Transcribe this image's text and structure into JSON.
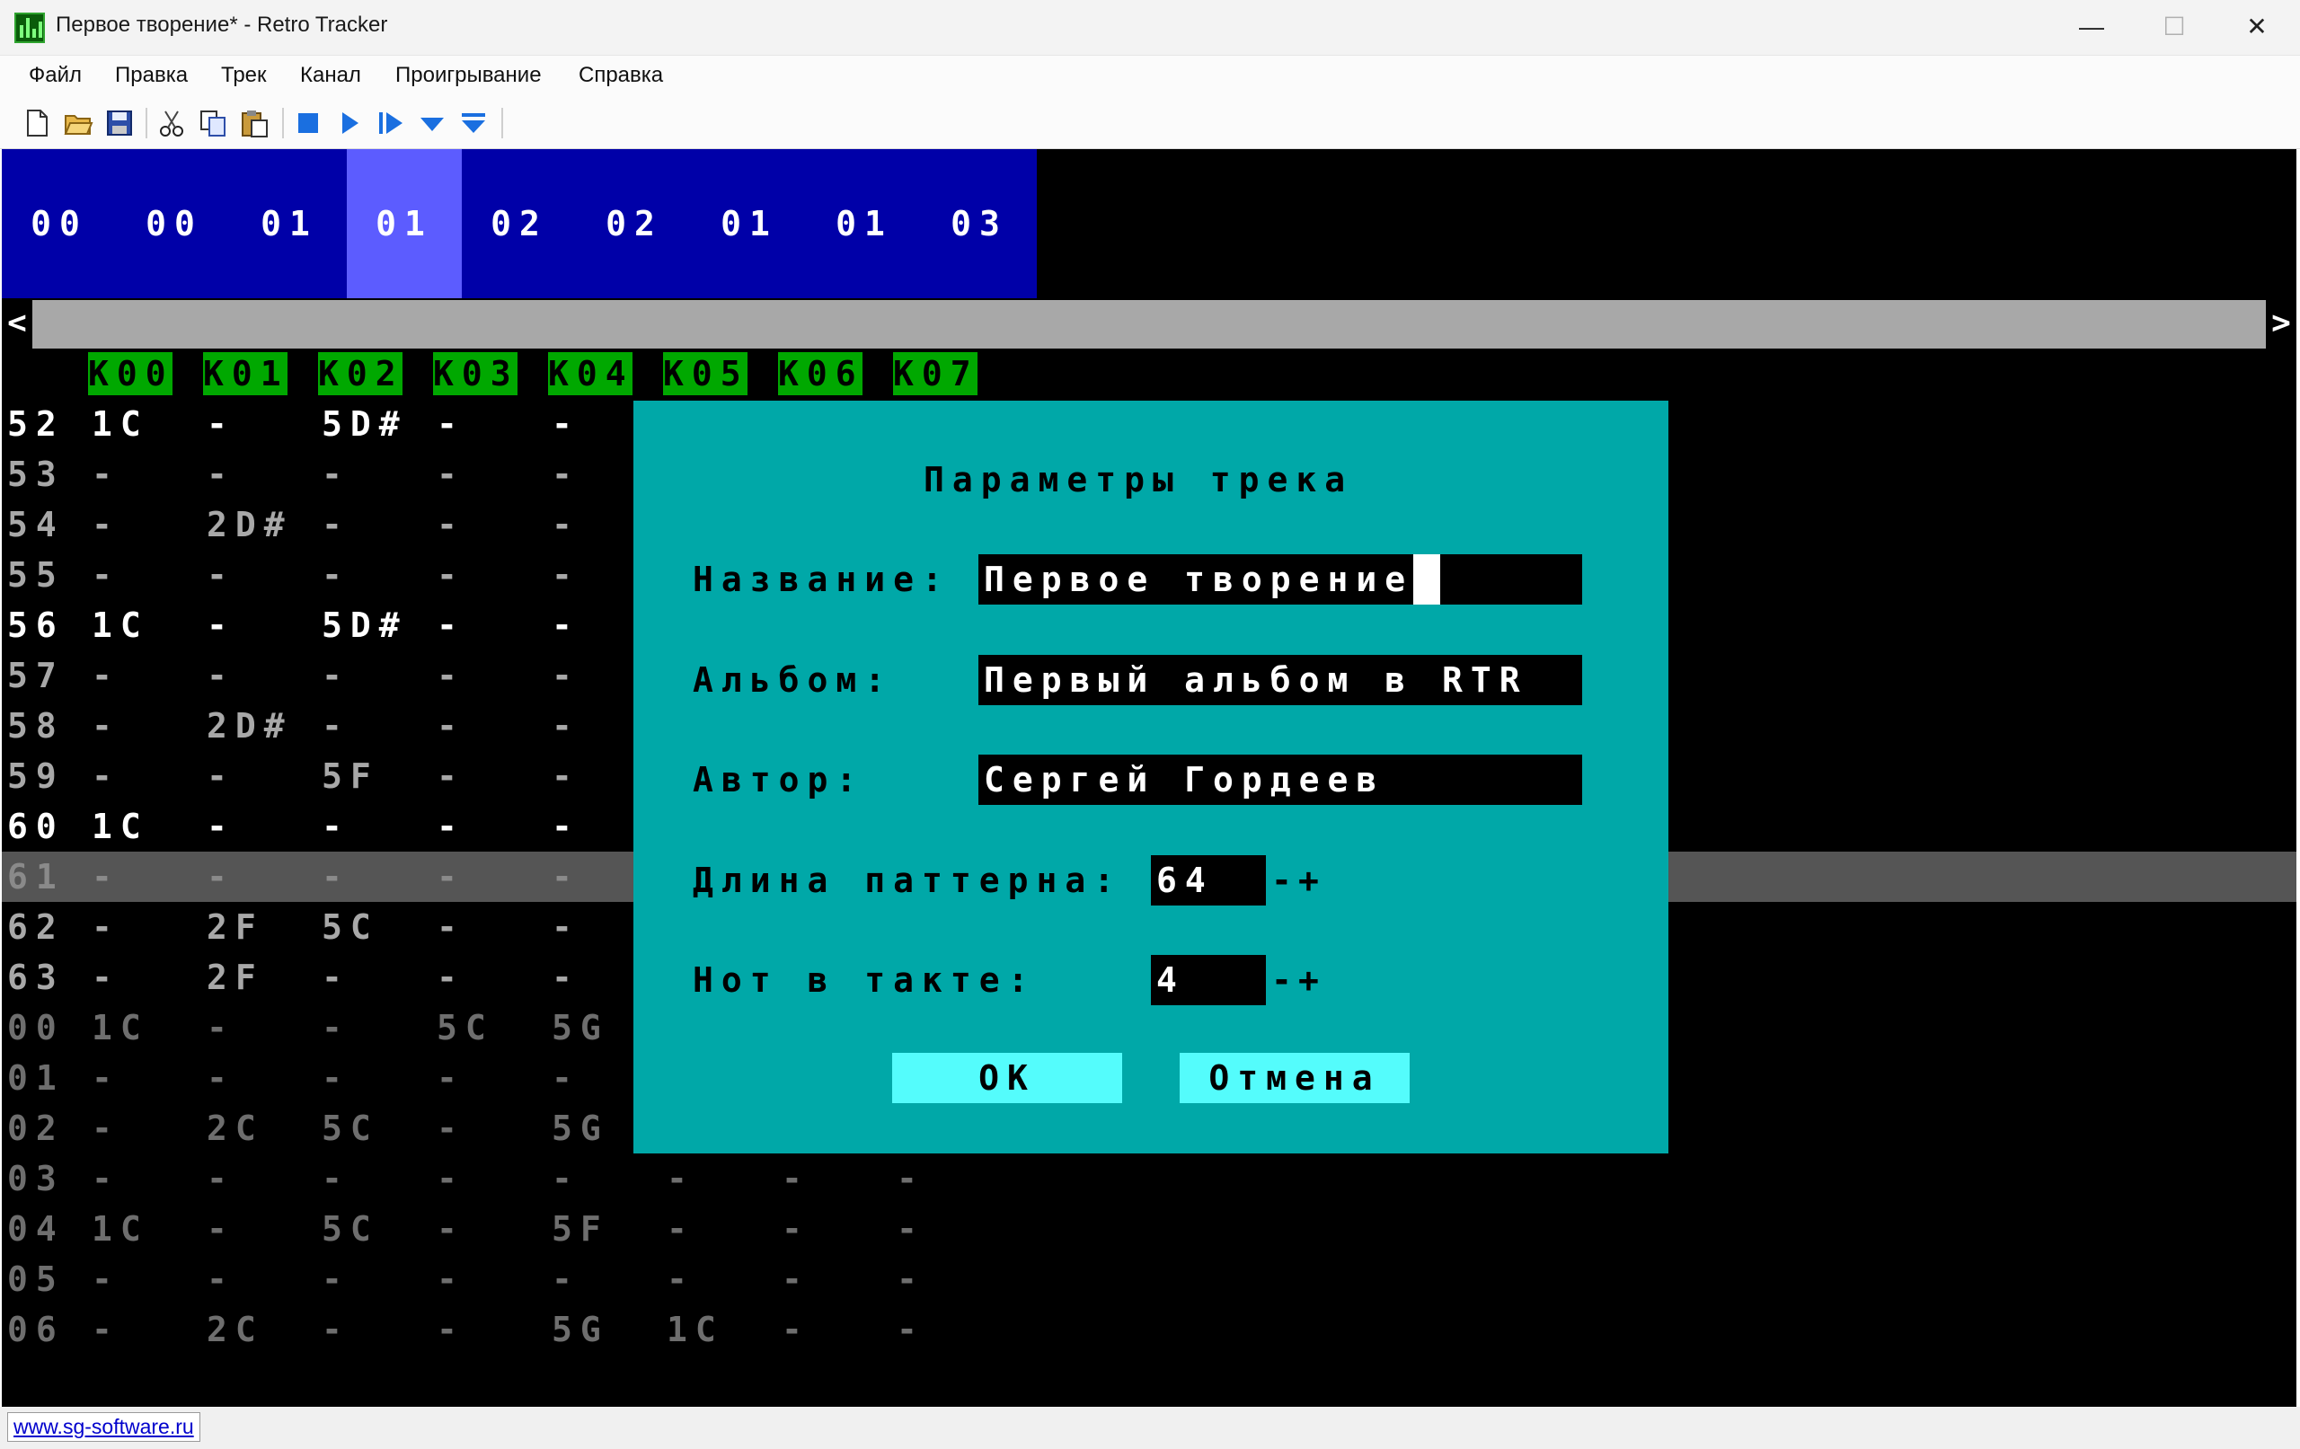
{
  "window": {
    "title": "Первое творение* - Retro Tracker",
    "minimize": "—",
    "maximize": "☐",
    "close": "✕"
  },
  "menu": [
    "Файл",
    "Правка",
    "Трек",
    "Канал",
    "Проигрывание",
    "Справка"
  ],
  "toolbar": [
    "new-icon",
    "open-icon",
    "save-icon",
    "cut-icon",
    "copy-icon",
    "paste-icon",
    "stop-icon",
    "play-icon",
    "play-pattern-icon",
    "follow-icon",
    "follow-all-icon"
  ],
  "order_list": [
    "00",
    "00",
    "01",
    "01",
    "02",
    "02",
    "01",
    "01",
    "03"
  ],
  "order_selected_index": 3,
  "scroll": {
    "left": "<",
    "right": ">"
  },
  "channels": [
    "K00",
    "K01",
    "K02",
    "K03",
    "K04",
    "K05",
    "K06",
    "K07"
  ],
  "pattern_rows": [
    {
      "num": "52",
      "cells": [
        "1C",
        "-",
        "5D#",
        "-",
        "-"
      ],
      "style": "bright"
    },
    {
      "num": "53",
      "cells": [
        "-",
        "-",
        "-",
        "-",
        "-"
      ],
      "style": "normal"
    },
    {
      "num": "54",
      "cells": [
        "-",
        "2D#",
        "-",
        "-",
        "-"
      ],
      "style": "normal"
    },
    {
      "num": "55",
      "cells": [
        "-",
        "-",
        "-",
        "-",
        "-"
      ],
      "style": "normal"
    },
    {
      "num": "56",
      "cells": [
        "1C",
        "-",
        "5D#",
        "-",
        "-"
      ],
      "style": "bright"
    },
    {
      "num": "57",
      "cells": [
        "-",
        "-",
        "-",
        "-",
        "-"
      ],
      "style": "normal"
    },
    {
      "num": "58",
      "cells": [
        "-",
        "2D#",
        "-",
        "-",
        "-"
      ],
      "style": "normal"
    },
    {
      "num": "59",
      "cells": [
        "-",
        "-",
        "5F",
        "-",
        "-"
      ],
      "style": "normal"
    },
    {
      "num": "60",
      "cells": [
        "1C",
        "-",
        "-",
        "-",
        "-"
      ],
      "style": "bright"
    },
    {
      "num": "61",
      "cells": [
        "-",
        "-",
        "-",
        "-",
        "-"
      ],
      "style": "current"
    },
    {
      "num": "62",
      "cells": [
        "-",
        "2F",
        "5C",
        "-",
        "-"
      ],
      "style": "normal"
    },
    {
      "num": "63",
      "cells": [
        "-",
        "2F",
        "-",
        "-",
        "-"
      ],
      "style": "normal"
    },
    {
      "num": "00",
      "cells": [
        "1C",
        "-",
        "-",
        "5C",
        "5G"
      ],
      "style": "dim"
    },
    {
      "num": "01",
      "cells": [
        "-",
        "-",
        "-",
        "-",
        "-"
      ],
      "style": "dim"
    },
    {
      "num": "02",
      "cells": [
        "-",
        "2C",
        "5C",
        "-",
        "5G"
      ],
      "style": "dim"
    },
    {
      "num": "03",
      "cells": [
        "-",
        "-",
        "-",
        "-",
        "-",
        "-",
        "-",
        "-"
      ],
      "style": "dim"
    },
    {
      "num": "04",
      "cells": [
        "1C",
        "-",
        "5C",
        "-",
        "5F",
        "-",
        "-",
        "-"
      ],
      "style": "dim"
    },
    {
      "num": "05",
      "cells": [
        "-",
        "-",
        "-",
        "-",
        "-",
        "-",
        "-",
        "-"
      ],
      "style": "dim"
    },
    {
      "num": "06",
      "cells": [
        "-",
        "2C",
        "-",
        "-",
        "5G",
        "1C",
        "-",
        "-"
      ],
      "style": "dim"
    }
  ],
  "dialog": {
    "title": "Параметры трека",
    "name_label": "Название:",
    "name_value": "Первое творение",
    "album_label": "Альбом:",
    "album_value": "Первый альбом в RTR",
    "author_label": "Автор:",
    "author_value": "Сергей Гордеев",
    "pattern_len_label": "Длина паттерна:",
    "pattern_len_value": "64",
    "notes_label": "Нот в такте:",
    "notes_value": "4",
    "minus": "-",
    "plus": "+",
    "ok": "OK",
    "cancel": "Отмена"
  },
  "status": {
    "link": "www.sg-software.ru"
  },
  "colors": {
    "order_bg": "#0000a8",
    "order_selected": "#5c5cff",
    "channel_header": "#00a800",
    "dialog_bg": "#00a8a8",
    "dialog_button": "#54fcfc",
    "current_row": "#555555"
  }
}
